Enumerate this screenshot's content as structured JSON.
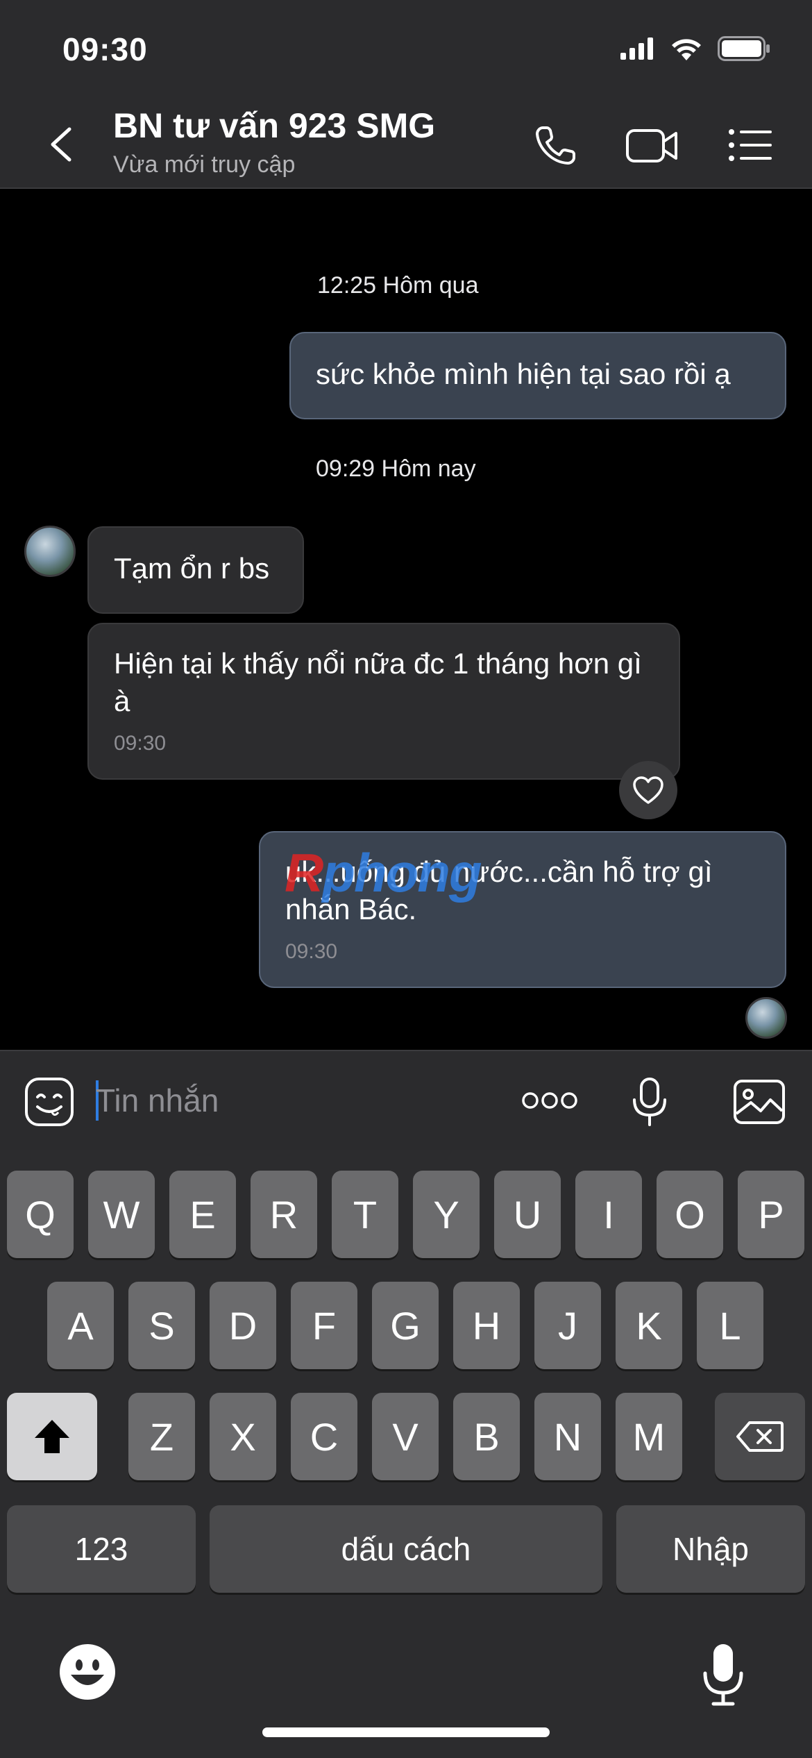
{
  "status_bar": {
    "time": "09:30"
  },
  "header": {
    "contact_name": "BN tư vấn 923 SMG",
    "contact_status": "Vừa mới truy cập"
  },
  "messages": [
    {
      "type": "timestamp",
      "text": "12:25 Hôm qua"
    },
    {
      "type": "outgoing",
      "text": "sức khỏe mình hiện tại sao rồi ạ"
    },
    {
      "type": "timestamp",
      "text": "09:29 Hôm nay"
    },
    {
      "type": "incoming",
      "text": "Tạm ổn r bs"
    },
    {
      "type": "incoming",
      "text": "Hiện tại k thấy nổi nữa đc 1 tháng hơn gì à",
      "time": "09:30"
    },
    {
      "type": "outgoing",
      "text": "uk...uống đủ nước...cần hỗ trợ gì nhắn Bác.",
      "time": "09:30"
    }
  ],
  "watermark": {
    "part1": "R",
    "part2": "phong"
  },
  "input": {
    "placeholder": "Tin nhắn"
  },
  "keyboard": {
    "row1": [
      "Q",
      "W",
      "E",
      "R",
      "T",
      "Y",
      "U",
      "I",
      "O",
      "P"
    ],
    "row2": [
      "A",
      "S",
      "D",
      "F",
      "G",
      "H",
      "J",
      "K",
      "L"
    ],
    "row3": [
      "Z",
      "X",
      "C",
      "V",
      "B",
      "N",
      "M"
    ],
    "numbers_label": "123",
    "space_label": "dấu cách",
    "return_label": "Nhập"
  },
  "colors": {
    "outgoing_bubble": "#3a4350",
    "incoming_bubble": "#2c2c2e",
    "accent": "#2f7de1"
  }
}
